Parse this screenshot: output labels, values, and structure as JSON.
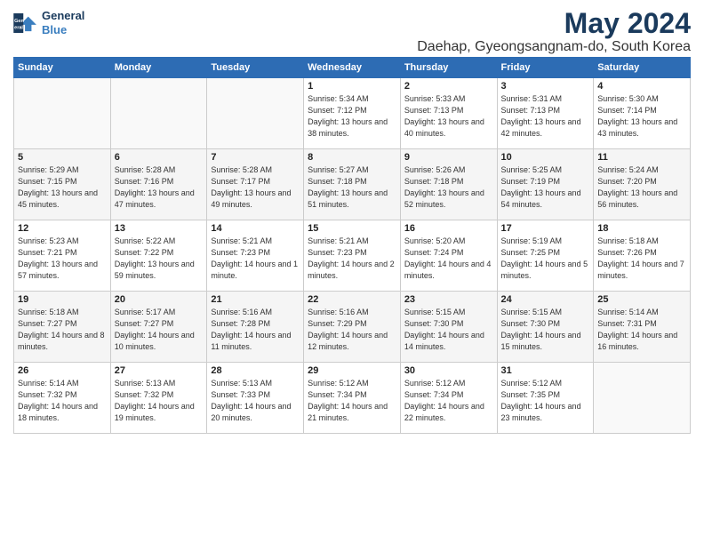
{
  "header": {
    "logo_line1": "General",
    "logo_line2": "Blue",
    "month_year": "May 2024",
    "location": "Daehap, Gyeongsangnam-do, South Korea"
  },
  "weekdays": [
    "Sunday",
    "Monday",
    "Tuesday",
    "Wednesday",
    "Thursday",
    "Friday",
    "Saturday"
  ],
  "weeks": [
    [
      {
        "day": "",
        "sunrise": "",
        "sunset": "",
        "daylight": ""
      },
      {
        "day": "",
        "sunrise": "",
        "sunset": "",
        "daylight": ""
      },
      {
        "day": "",
        "sunrise": "",
        "sunset": "",
        "daylight": ""
      },
      {
        "day": "1",
        "sunrise": "Sunrise: 5:34 AM",
        "sunset": "Sunset: 7:12 PM",
        "daylight": "Daylight: 13 hours and 38 minutes."
      },
      {
        "day": "2",
        "sunrise": "Sunrise: 5:33 AM",
        "sunset": "Sunset: 7:13 PM",
        "daylight": "Daylight: 13 hours and 40 minutes."
      },
      {
        "day": "3",
        "sunrise": "Sunrise: 5:31 AM",
        "sunset": "Sunset: 7:13 PM",
        "daylight": "Daylight: 13 hours and 42 minutes."
      },
      {
        "day": "4",
        "sunrise": "Sunrise: 5:30 AM",
        "sunset": "Sunset: 7:14 PM",
        "daylight": "Daylight: 13 hours and 43 minutes."
      }
    ],
    [
      {
        "day": "5",
        "sunrise": "Sunrise: 5:29 AM",
        "sunset": "Sunset: 7:15 PM",
        "daylight": "Daylight: 13 hours and 45 minutes."
      },
      {
        "day": "6",
        "sunrise": "Sunrise: 5:28 AM",
        "sunset": "Sunset: 7:16 PM",
        "daylight": "Daylight: 13 hours and 47 minutes."
      },
      {
        "day": "7",
        "sunrise": "Sunrise: 5:28 AM",
        "sunset": "Sunset: 7:17 PM",
        "daylight": "Daylight: 13 hours and 49 minutes."
      },
      {
        "day": "8",
        "sunrise": "Sunrise: 5:27 AM",
        "sunset": "Sunset: 7:18 PM",
        "daylight": "Daylight: 13 hours and 51 minutes."
      },
      {
        "day": "9",
        "sunrise": "Sunrise: 5:26 AM",
        "sunset": "Sunset: 7:18 PM",
        "daylight": "Daylight: 13 hours and 52 minutes."
      },
      {
        "day": "10",
        "sunrise": "Sunrise: 5:25 AM",
        "sunset": "Sunset: 7:19 PM",
        "daylight": "Daylight: 13 hours and 54 minutes."
      },
      {
        "day": "11",
        "sunrise": "Sunrise: 5:24 AM",
        "sunset": "Sunset: 7:20 PM",
        "daylight": "Daylight: 13 hours and 56 minutes."
      }
    ],
    [
      {
        "day": "12",
        "sunrise": "Sunrise: 5:23 AM",
        "sunset": "Sunset: 7:21 PM",
        "daylight": "Daylight: 13 hours and 57 minutes."
      },
      {
        "day": "13",
        "sunrise": "Sunrise: 5:22 AM",
        "sunset": "Sunset: 7:22 PM",
        "daylight": "Daylight: 13 hours and 59 minutes."
      },
      {
        "day": "14",
        "sunrise": "Sunrise: 5:21 AM",
        "sunset": "Sunset: 7:23 PM",
        "daylight": "Daylight: 14 hours and 1 minute."
      },
      {
        "day": "15",
        "sunrise": "Sunrise: 5:21 AM",
        "sunset": "Sunset: 7:23 PM",
        "daylight": "Daylight: 14 hours and 2 minutes."
      },
      {
        "day": "16",
        "sunrise": "Sunrise: 5:20 AM",
        "sunset": "Sunset: 7:24 PM",
        "daylight": "Daylight: 14 hours and 4 minutes."
      },
      {
        "day": "17",
        "sunrise": "Sunrise: 5:19 AM",
        "sunset": "Sunset: 7:25 PM",
        "daylight": "Daylight: 14 hours and 5 minutes."
      },
      {
        "day": "18",
        "sunrise": "Sunrise: 5:18 AM",
        "sunset": "Sunset: 7:26 PM",
        "daylight": "Daylight: 14 hours and 7 minutes."
      }
    ],
    [
      {
        "day": "19",
        "sunrise": "Sunrise: 5:18 AM",
        "sunset": "Sunset: 7:27 PM",
        "daylight": "Daylight: 14 hours and 8 minutes."
      },
      {
        "day": "20",
        "sunrise": "Sunrise: 5:17 AM",
        "sunset": "Sunset: 7:27 PM",
        "daylight": "Daylight: 14 hours and 10 minutes."
      },
      {
        "day": "21",
        "sunrise": "Sunrise: 5:16 AM",
        "sunset": "Sunset: 7:28 PM",
        "daylight": "Daylight: 14 hours and 11 minutes."
      },
      {
        "day": "22",
        "sunrise": "Sunrise: 5:16 AM",
        "sunset": "Sunset: 7:29 PM",
        "daylight": "Daylight: 14 hours and 12 minutes."
      },
      {
        "day": "23",
        "sunrise": "Sunrise: 5:15 AM",
        "sunset": "Sunset: 7:30 PM",
        "daylight": "Daylight: 14 hours and 14 minutes."
      },
      {
        "day": "24",
        "sunrise": "Sunrise: 5:15 AM",
        "sunset": "Sunset: 7:30 PM",
        "daylight": "Daylight: 14 hours and 15 minutes."
      },
      {
        "day": "25",
        "sunrise": "Sunrise: 5:14 AM",
        "sunset": "Sunset: 7:31 PM",
        "daylight": "Daylight: 14 hours and 16 minutes."
      }
    ],
    [
      {
        "day": "26",
        "sunrise": "Sunrise: 5:14 AM",
        "sunset": "Sunset: 7:32 PM",
        "daylight": "Daylight: 14 hours and 18 minutes."
      },
      {
        "day": "27",
        "sunrise": "Sunrise: 5:13 AM",
        "sunset": "Sunset: 7:32 PM",
        "daylight": "Daylight: 14 hours and 19 minutes."
      },
      {
        "day": "28",
        "sunrise": "Sunrise: 5:13 AM",
        "sunset": "Sunset: 7:33 PM",
        "daylight": "Daylight: 14 hours and 20 minutes."
      },
      {
        "day": "29",
        "sunrise": "Sunrise: 5:12 AM",
        "sunset": "Sunset: 7:34 PM",
        "daylight": "Daylight: 14 hours and 21 minutes."
      },
      {
        "day": "30",
        "sunrise": "Sunrise: 5:12 AM",
        "sunset": "Sunset: 7:34 PM",
        "daylight": "Daylight: 14 hours and 22 minutes."
      },
      {
        "day": "31",
        "sunrise": "Sunrise: 5:12 AM",
        "sunset": "Sunset: 7:35 PM",
        "daylight": "Daylight: 14 hours and 23 minutes."
      },
      {
        "day": "",
        "sunrise": "",
        "sunset": "",
        "daylight": ""
      }
    ]
  ]
}
